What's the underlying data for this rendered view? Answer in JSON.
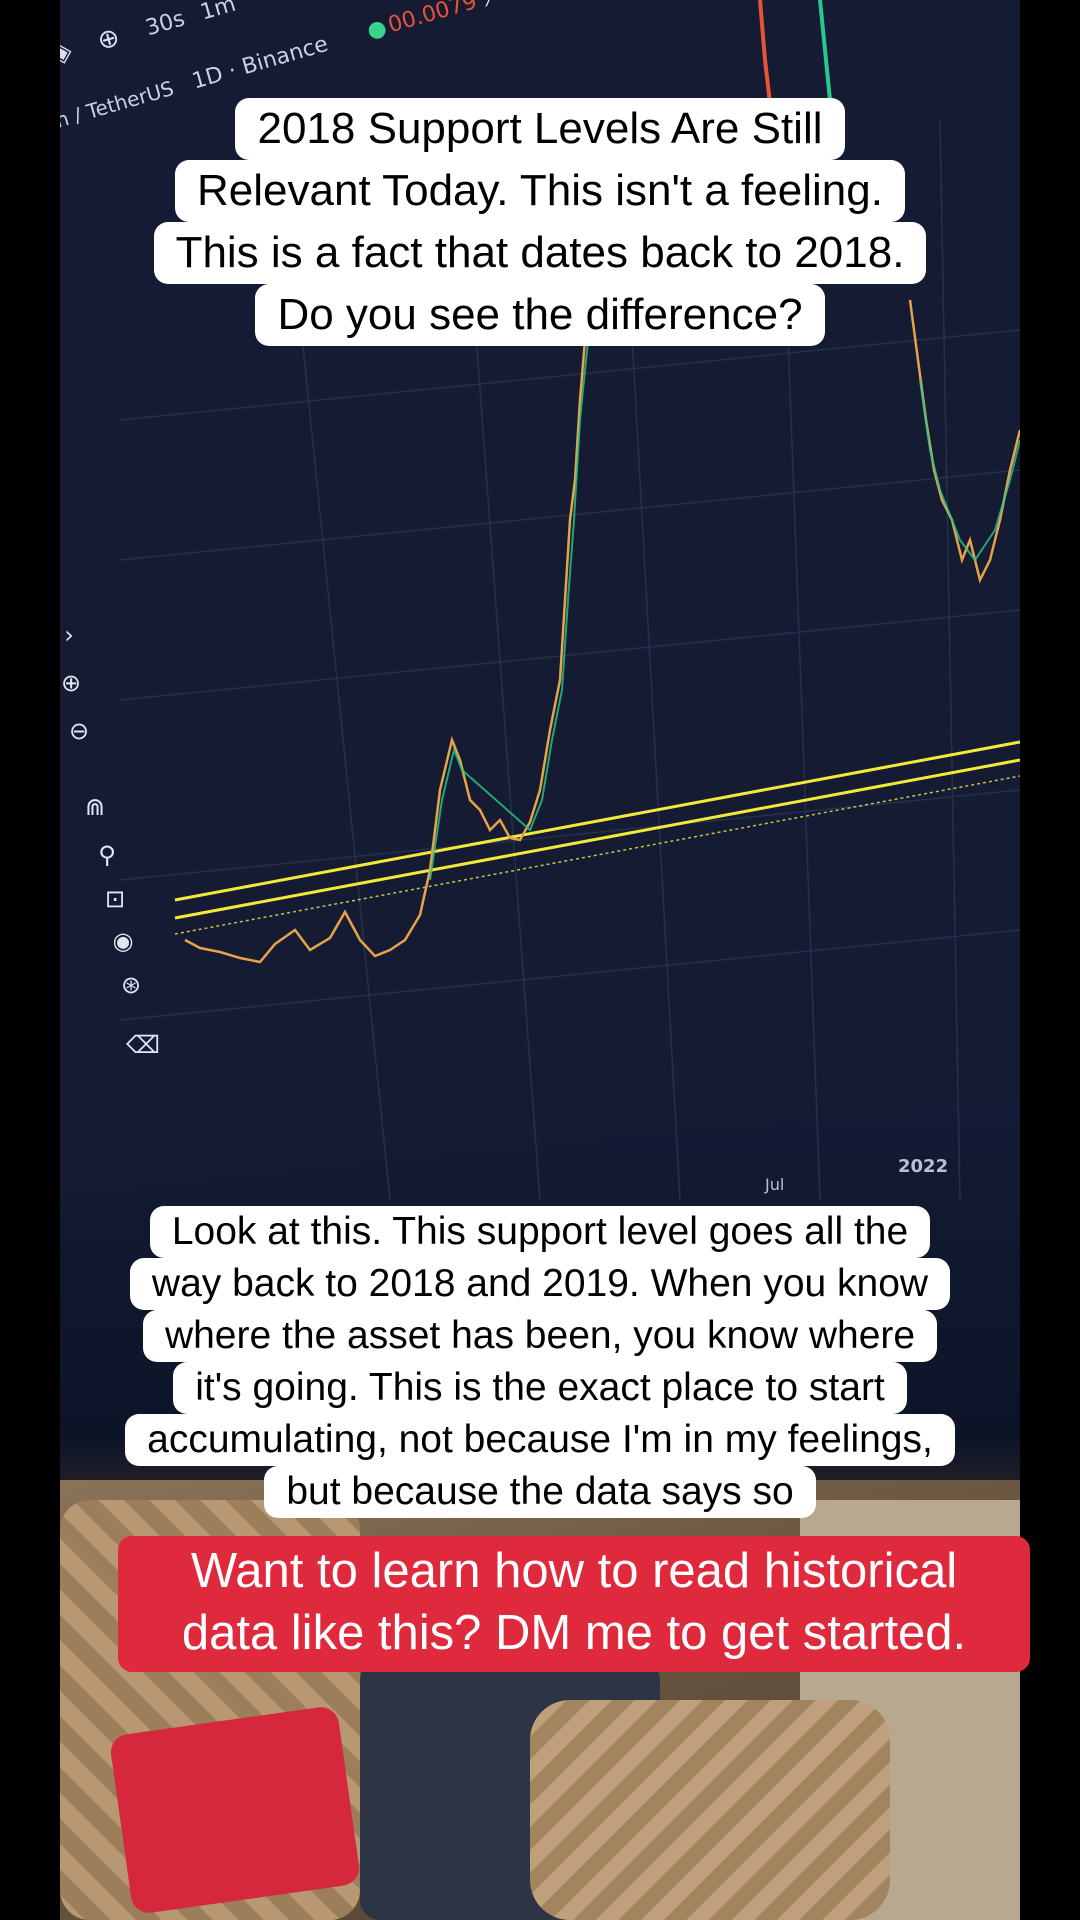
{
  "toolbar": {
    "interval_1": "30s",
    "interval_2": "1m",
    "symbol": "n / TetherUS",
    "timeframe_exchange": "1D · Binance",
    "price_fragment": "00.0079"
  },
  "time_axis": {
    "label_1": "Jul",
    "label_2": "2022"
  },
  "caption_top": {
    "lines": [
      "2018 Support Levels Are Still",
      "Relevant Today. This isn't a feeling.",
      "This is a fact that dates back to 2018.",
      "Do you see the difference?"
    ]
  },
  "caption_mid": {
    "lines": [
      "Look at this. This support level goes all the",
      "way back to 2018 and 2019. When you know",
      "where the asset has been, you know where",
      "it's going. This is the exact place to start",
      "accumulating, not because I'm in my feelings,",
      "but because the data says so"
    ]
  },
  "cta": {
    "lines": [
      "Want to learn how to read historical",
      "data like this? DM me to get started."
    ]
  },
  "colors": {
    "chart_bg": "#141b33",
    "support_line": "#f2ea3a",
    "candle_up": "#26c98a",
    "candle_down": "#e8523a",
    "cta_bg": "#df2a3e"
  }
}
